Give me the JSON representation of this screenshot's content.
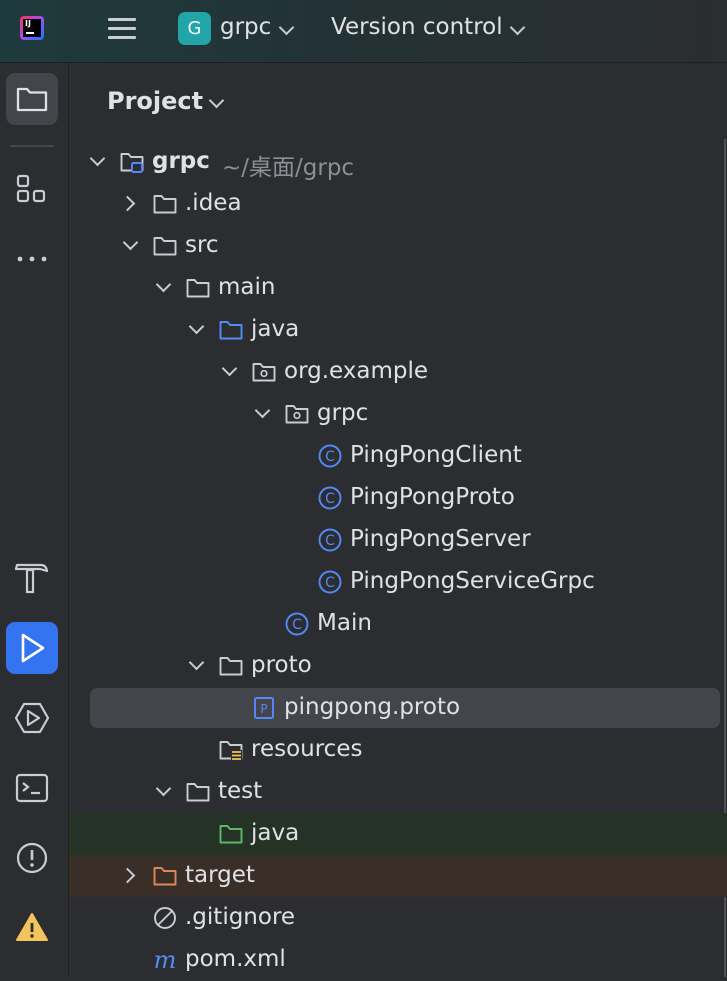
{
  "header": {
    "app_icon": "intellij-idea-logo",
    "app_logo_text": "IJ",
    "project_badge": "G",
    "project_name": "grpc",
    "vcs_label": "Version control"
  },
  "toolstrip": {
    "top": [
      "project-folder-icon",
      "structure-icon",
      "more-icon"
    ],
    "bottom": [
      "build-hammer-icon",
      "run-icon",
      "services-icon",
      "terminal-icon",
      "problems-icon",
      "warning-icon"
    ]
  },
  "panel": {
    "title": "Project"
  },
  "tree": [
    {
      "label": "grpc",
      "hint": "~/桌面/grpc",
      "depth": 0,
      "expanded": true,
      "icon": "module-folder-icon"
    },
    {
      "label": ".idea",
      "depth": 1,
      "expanded": false,
      "icon": "folder-icon"
    },
    {
      "label": "src",
      "depth": 1,
      "expanded": true,
      "icon": "folder-icon"
    },
    {
      "label": "main",
      "depth": 2,
      "expanded": true,
      "icon": "folder-icon"
    },
    {
      "label": "java",
      "depth": 3,
      "expanded": true,
      "icon": "source-folder-icon"
    },
    {
      "label": "org.example",
      "depth": 4,
      "expanded": true,
      "icon": "package-icon"
    },
    {
      "label": "grpc",
      "depth": 5,
      "expanded": true,
      "icon": "package-icon"
    },
    {
      "label": "PingPongClient",
      "depth": 6,
      "icon": "java-class-icon"
    },
    {
      "label": "PingPongProto",
      "depth": 6,
      "icon": "java-class-icon"
    },
    {
      "label": "PingPongServer",
      "depth": 6,
      "icon": "java-class-icon"
    },
    {
      "label": "PingPongServiceGrpc",
      "depth": 6,
      "icon": "java-class-icon"
    },
    {
      "label": "Main",
      "depth": 5,
      "icon": "java-class-icon"
    },
    {
      "label": "proto",
      "depth": 3,
      "expanded": true,
      "icon": "folder-icon"
    },
    {
      "label": "pingpong.proto",
      "depth": 4,
      "icon": "proto-file-icon",
      "selected": true
    },
    {
      "label": "resources",
      "depth": 3,
      "icon": "resources-folder-icon"
    },
    {
      "label": "test",
      "depth": 2,
      "expanded": true,
      "icon": "folder-icon"
    },
    {
      "label": "java",
      "depth": 3,
      "icon": "test-folder-icon",
      "highlight": "test"
    },
    {
      "label": "target",
      "depth": 1,
      "expanded": false,
      "icon": "excluded-folder-icon",
      "highlight": "excluded"
    },
    {
      "label": ".gitignore",
      "depth": 1,
      "icon": "ignored-file-icon"
    },
    {
      "label": "pom.xml",
      "depth": 1,
      "icon": "maven-icon"
    }
  ],
  "colors": {
    "accent": "#3574f0",
    "class_icon": "#548af7",
    "test_folder": "#5fb865",
    "excluded_folder": "#e08855",
    "warning": "#f2c55c"
  }
}
